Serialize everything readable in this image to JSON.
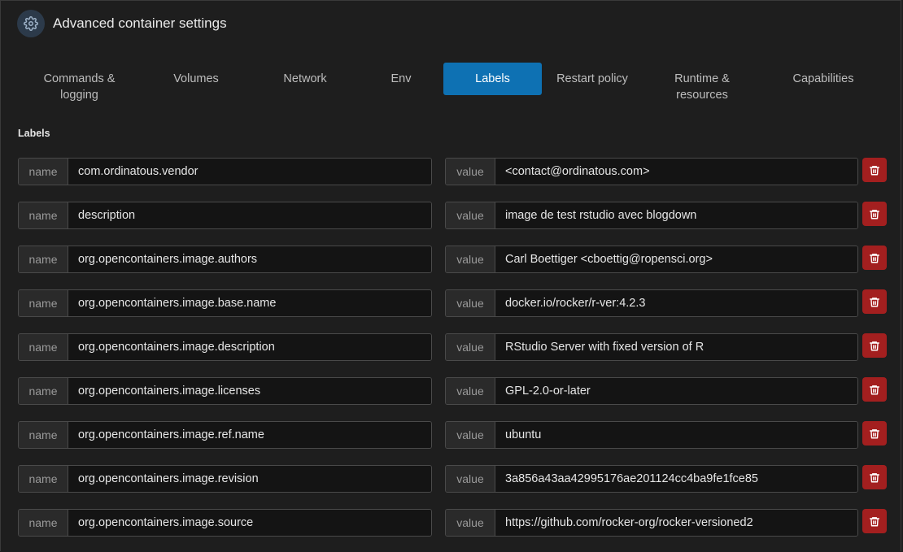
{
  "header": {
    "title": "Advanced container settings",
    "icon": "gear-icon"
  },
  "tabs": [
    {
      "label": "Commands &\nlogging",
      "active": false
    },
    {
      "label": "Volumes",
      "active": false
    },
    {
      "label": "Network",
      "active": false
    },
    {
      "label": "Env",
      "active": false
    },
    {
      "label": "Labels",
      "active": true
    },
    {
      "label": "Restart policy",
      "active": false
    },
    {
      "label": "Runtime &\nresources",
      "active": false
    },
    {
      "label": "Capabilities",
      "active": false
    }
  ],
  "labels_section": {
    "title": "Labels",
    "name_addon": "name",
    "value_addon": "value",
    "items": [
      {
        "name": "com.ordinatous.vendor",
        "value": "<contact@ordinatous.com>"
      },
      {
        "name": "description",
        "value": "image de test rstudio avec blogdown"
      },
      {
        "name": "org.opencontainers.image.authors",
        "value": "Carl Boettiger <cboettig@ropensci.org>"
      },
      {
        "name": "org.opencontainers.image.base.name",
        "value": "docker.io/rocker/r-ver:4.2.3"
      },
      {
        "name": "org.opencontainers.image.description",
        "value": "RStudio Server with fixed version of R"
      },
      {
        "name": "org.opencontainers.image.licenses",
        "value": "GPL-2.0-or-later"
      },
      {
        "name": "org.opencontainers.image.ref.name",
        "value": "ubuntu"
      },
      {
        "name": "org.opencontainers.image.revision",
        "value": "3a856a43aa42995176ae201124cc4ba9fe1fce85"
      },
      {
        "name": "org.opencontainers.image.source",
        "value": "https://github.com/rocker-org/rocker-versioned2"
      }
    ]
  },
  "colors": {
    "accent": "#0e71b3",
    "danger": "#a31f1f",
    "background": "#1e1e1e"
  }
}
